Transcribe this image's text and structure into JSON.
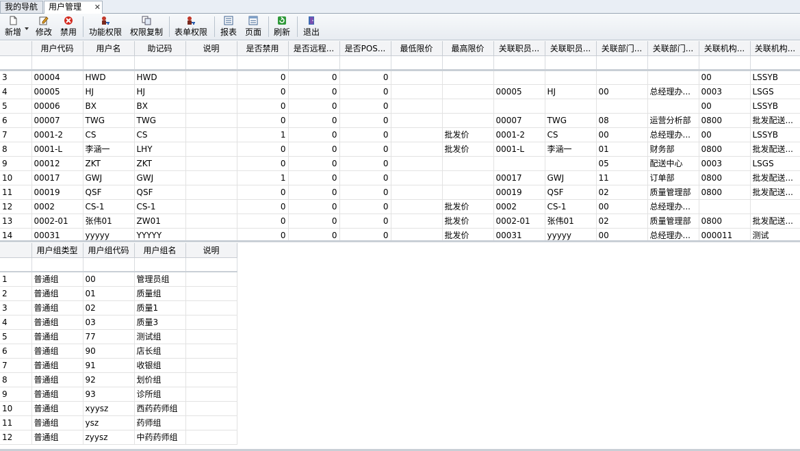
{
  "tabs": [
    {
      "label": "我的导航",
      "active": false
    },
    {
      "label": "用户管理",
      "active": true
    }
  ],
  "tab_close": "✕",
  "toolbar": {
    "add": "新增",
    "edit": "修改",
    "disable": "禁用",
    "func_perm": "功能权限",
    "copy_perm": "权限复制",
    "form_perm": "表单权限",
    "report": "报表",
    "page": "页面",
    "refresh": "刷新",
    "exit": "退出"
  },
  "users": {
    "columns": [
      "用户代码",
      "用户名",
      "助记码",
      "说明",
      "是否禁用",
      "是否远程...",
      "是否POS...",
      "最低限价",
      "最高限价",
      "关联职员...",
      "关联职员...",
      "关联部门...",
      "关联部门...",
      "关联机构...",
      "关联机构..."
    ],
    "rows": [
      [
        "3",
        "00004",
        "HWD",
        "HWD",
        "",
        "0",
        "0",
        "0",
        "",
        "",
        "",
        "",
        "",
        "",
        "00",
        "LSSYB"
      ],
      [
        "4",
        "00005",
        "HJ",
        "HJ",
        "",
        "0",
        "0",
        "0",
        "",
        "",
        "00005",
        "HJ",
        "00",
        "总经理办...",
        "0003",
        "LSGS"
      ],
      [
        "5",
        "00006",
        "BX",
        "BX",
        "",
        "0",
        "0",
        "0",
        "",
        "",
        "",
        "",
        "",
        "",
        "00",
        "LSSYB"
      ],
      [
        "6",
        "00007",
        "TWG",
        "TWG",
        "",
        "0",
        "0",
        "0",
        "",
        "",
        "00007",
        "TWG",
        "08",
        "运营分析部",
        "0800",
        "批发配送..."
      ],
      [
        "7",
        "0001-2",
        "CS",
        "CS",
        "",
        "1",
        "0",
        "0",
        "",
        "批发价",
        "0001-2",
        "CS",
        "00",
        "总经理办...",
        "00",
        "LSSYB"
      ],
      [
        "8",
        "0001-L",
        "李涵一",
        "LHY",
        "",
        "0",
        "0",
        "0",
        "",
        "批发价",
        "0001-L",
        "李涵一",
        "01",
        "财务部",
        "0800",
        "批发配送..."
      ],
      [
        "9",
        "00012",
        "ZKT",
        "ZKT",
        "",
        "0",
        "0",
        "0",
        "",
        "",
        "",
        "",
        "05",
        "配送中心",
        "0003",
        "LSGS"
      ],
      [
        "10",
        "00017",
        "GWJ",
        "GWJ",
        "",
        "1",
        "0",
        "0",
        "",
        "",
        "00017",
        "GWJ",
        "11",
        "订单部",
        "0800",
        "批发配送..."
      ],
      [
        "11",
        "00019",
        "QSF",
        "QSF",
        "",
        "0",
        "0",
        "0",
        "",
        "",
        "00019",
        "QSF",
        "02",
        "质量管理部",
        "0800",
        "批发配送..."
      ],
      [
        "12",
        "0002",
        "CS-1",
        "CS-1",
        "",
        "0",
        "0",
        "0",
        "",
        "批发价",
        "0002",
        "CS-1",
        "00",
        "总经理办...",
        "",
        ""
      ],
      [
        "13",
        "0002-01",
        "张伟01",
        "ZW01",
        "",
        "0",
        "0",
        "0",
        "",
        "批发价",
        "0002-01",
        "张伟01",
        "02",
        "质量管理部",
        "0800",
        "批发配送..."
      ],
      [
        "14",
        "00031",
        "yyyyy",
        "YYYYY",
        "",
        "0",
        "0",
        "0",
        "",
        "批发价",
        "00031",
        "yyyyy",
        "00",
        "总经理办...",
        "000011",
        "测试"
      ]
    ]
  },
  "groups": {
    "columns": [
      "用户组类型",
      "用户组代码",
      "用户组名",
      "说明"
    ],
    "rows": [
      [
        "1",
        "普通组",
        "00",
        "管理员组",
        ""
      ],
      [
        "2",
        "普通组",
        "01",
        "质量组",
        ""
      ],
      [
        "3",
        "普通组",
        "02",
        "质量1",
        ""
      ],
      [
        "4",
        "普通组",
        "03",
        "质量3",
        ""
      ],
      [
        "5",
        "普通组",
        "77",
        "测试组",
        ""
      ],
      [
        "6",
        "普通组",
        "90",
        "店长组",
        ""
      ],
      [
        "7",
        "普通组",
        "91",
        "收银组",
        ""
      ],
      [
        "8",
        "普通组",
        "92",
        "划价组",
        ""
      ],
      [
        "9",
        "普通组",
        "93",
        "诊所组",
        ""
      ],
      [
        "10",
        "普通组",
        "xyysz",
        "西药药师组",
        ""
      ],
      [
        "11",
        "普通组",
        "ysz",
        "药师组",
        ""
      ],
      [
        "12",
        "普通组",
        "zyysz",
        "中药药师组",
        ""
      ]
    ]
  },
  "colors": {
    "header_bg": "#f3f4f6",
    "tab_bar": "#e9eef5"
  }
}
